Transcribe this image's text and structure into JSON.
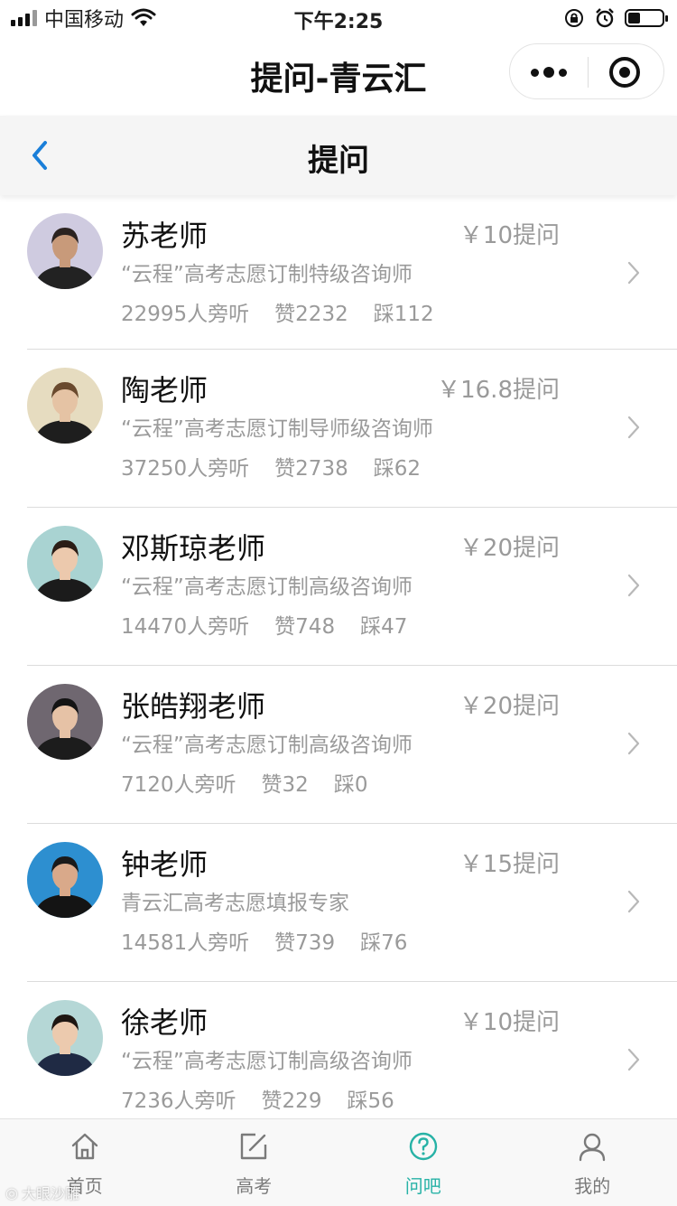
{
  "status_bar": {
    "carrier": "中国移动",
    "time": "下午2:25",
    "battery_level": 0.35
  },
  "titlebar": {
    "title": "提问-青云汇"
  },
  "page": {
    "title": "提问"
  },
  "teachers": [
    {
      "name": "苏老师",
      "price": "￥10提问",
      "desc": "“云程”高考志愿订制特级咨询师",
      "listeners": "22995人旁听",
      "likes": "赞2232",
      "dislikes": "踩112",
      "bg": "#cfcbe0",
      "cloth": "#222222",
      "skin": "#c89a7a",
      "hair": "#2b2320"
    },
    {
      "name": "陶老师",
      "price": "￥16.8提问",
      "desc": "“云程”高考志愿订制导师级咨询师",
      "listeners": "37250人旁听",
      "likes": "赞2738",
      "dislikes": "踩62",
      "bg": "#e6dcc0",
      "cloth": "#1e1e1e",
      "skin": "#e5c3a4",
      "hair": "#6a4a2e"
    },
    {
      "name": "邓斯琼老师",
      "price": "￥20提问",
      "desc": "“云程”高考志愿订制高级咨询师",
      "listeners": "14470人旁听",
      "likes": "赞748",
      "dislikes": "踩47",
      "bg": "#a9d3d2",
      "cloth": "#1b1b1b",
      "skin": "#ecc9ad",
      "hair": "#2b1d16"
    },
    {
      "name": "张皓翔老师",
      "price": "￥20提问",
      "desc": "“云程”高考志愿订制高级咨询师",
      "listeners": "7120人旁听",
      "likes": "赞32",
      "dislikes": "踩0",
      "bg": "#6f6770",
      "cloth": "#1c1c1c",
      "skin": "#e6c2a6",
      "hair": "#141414"
    },
    {
      "name": "钟老师",
      "price": "￥15提问",
      "desc": "青云汇高考志愿填报专家",
      "listeners": "14581人旁听",
      "likes": "赞739",
      "dislikes": "踩76",
      "bg": "#2d8fd0",
      "cloth": "#141414",
      "skin": "#d9a98a",
      "hair": "#1a1a1a"
    },
    {
      "name": "徐老师",
      "price": "￥10提问",
      "desc": "“云程”高考志愿订制高级咨询师",
      "listeners": "7236人旁听",
      "likes": "赞229",
      "dislikes": "踩56",
      "bg": "#b5d7d6",
      "cloth": "#1f2a44",
      "skin": "#eccaae",
      "hair": "#1e1612"
    }
  ],
  "tabs": [
    {
      "label": "首页",
      "icon": "home-icon"
    },
    {
      "label": "高考",
      "icon": "edit-icon"
    },
    {
      "label": "问吧",
      "icon": "question-icon",
      "active": true
    },
    {
      "label": "我的",
      "icon": "user-icon"
    }
  ],
  "watermark": "大眼沙雕",
  "colors": {
    "accent": "#27b2a6",
    "back_arrow": "#1a7fd9"
  }
}
